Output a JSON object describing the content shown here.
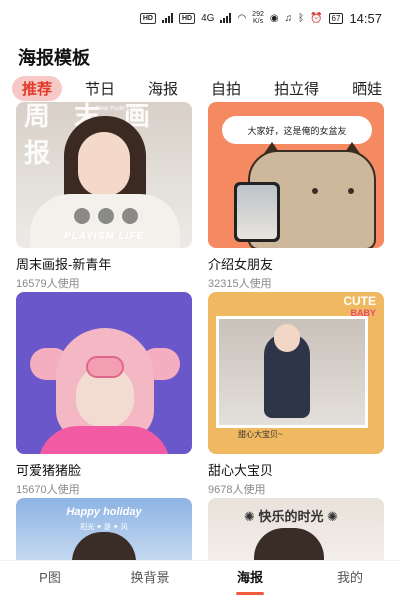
{
  "status_bar": {
    "hd1": "HD",
    "hd2": "HD",
    "sig1": "4G",
    "sig2": "4G",
    "net_speed_value": "292",
    "net_speed_unit": "K/s",
    "battery": "67",
    "time": "14:57"
  },
  "header": {
    "title": "海报模板"
  },
  "tabs": [
    {
      "label": "推荐",
      "active": true
    },
    {
      "label": "节日"
    },
    {
      "label": "海报"
    },
    {
      "label": "自拍"
    },
    {
      "label": "拍立得"
    },
    {
      "label": "晒娃"
    }
  ],
  "templates": [
    {
      "name": "周末画报-新青年",
      "uses": "16579人使用",
      "art": {
        "big_text": "周末画报",
        "sub_text": "New Youth China",
        "caption": "PLAYISM LIFE"
      }
    },
    {
      "name": "介绍女朋友",
      "uses": "32315人使用",
      "art": {
        "bubble": "大家好，这是俺的女盆友"
      }
    },
    {
      "name": "可爱猪猪脸",
      "uses": "15670人使用",
      "art": {}
    },
    {
      "name": "甜心大宝贝",
      "uses": "9678人使用",
      "art": {
        "cute": "CUTE",
        "baby": "BABY",
        "stamp": "甜心大宝贝~"
      }
    },
    {
      "name": "",
      "uses": "",
      "art": {
        "title": "Happy holiday",
        "line": "阳光 ✦ 是 ✦ 风"
      }
    },
    {
      "name": "",
      "uses": "",
      "art": {
        "title": "✺ 快乐的时光 ✺"
      }
    }
  ],
  "bottom_nav": [
    {
      "label": "P图"
    },
    {
      "label": "换背景"
    },
    {
      "label": "海报",
      "active": true
    },
    {
      "label": "我的"
    }
  ],
  "colors": {
    "accent": "#e33a2a",
    "tab_active_bg": "#f6c9c7",
    "nav_indicator": "#f25a3c"
  }
}
